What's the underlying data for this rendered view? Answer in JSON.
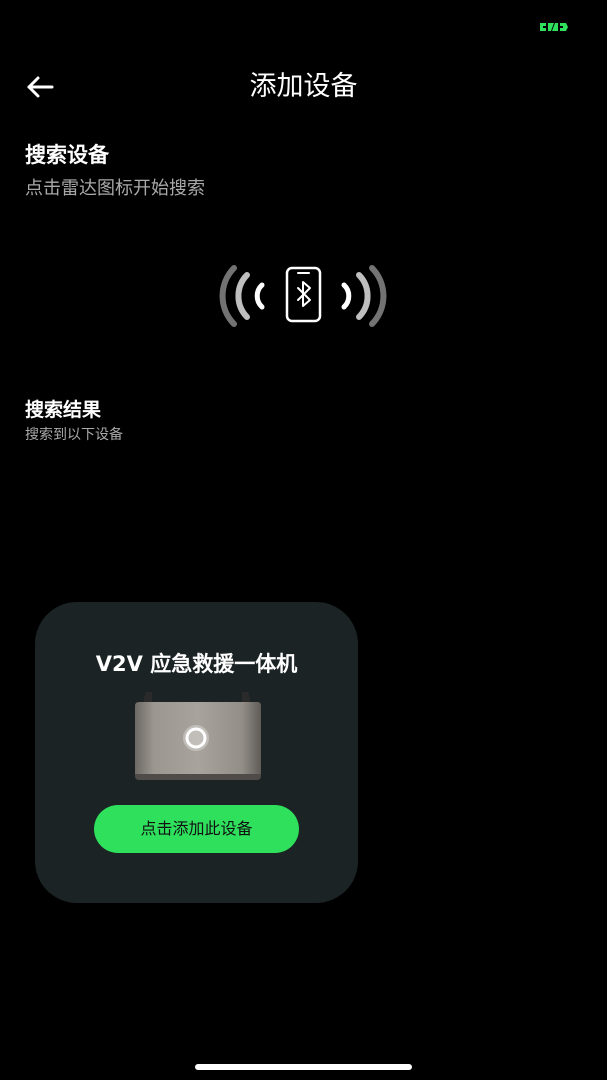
{
  "header": {
    "title": "添加设备"
  },
  "search": {
    "heading": "搜索设备",
    "hint": "点击雷达图标开始搜索",
    "radar_icon": "bluetooth-phone-radar-icon"
  },
  "results": {
    "heading": "搜索结果",
    "hint": "搜索到以下设备"
  },
  "device": {
    "name": "V2V 应急救援一体机",
    "add_button_label": "点击添加此设备"
  },
  "colors": {
    "background": "#000000",
    "card": "#1b2324",
    "accent": "#2ee05c",
    "secondary_text": "#a9a9a9"
  }
}
